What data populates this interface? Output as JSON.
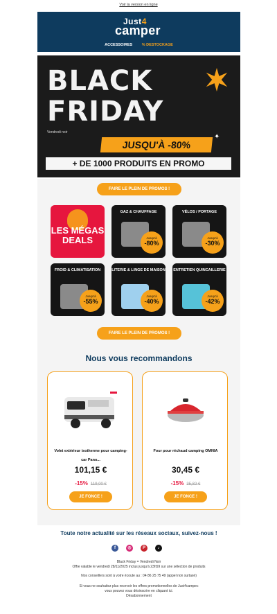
{
  "top_link": "Voir la version en ligne",
  "brand": {
    "line1_a": "Just",
    "line1_b": "4",
    "line2": "camper"
  },
  "nav": {
    "item1": "ACCESSOIRES",
    "item2": "% DESTOCKAGE"
  },
  "hero": {
    "title1": "BLACK",
    "title2": "FRIDAY",
    "small": "Vendredi noir",
    "upto": "JUSQU'À -80%",
    "band": "+ DE 1000 PRODUITS EN PROMO"
  },
  "cta": "FAIRE LE PLEIN DE PROMOS !",
  "categories": [
    {
      "label": "LES MÉGAS DEALS"
    },
    {
      "label": "GAZ & CHAUFFAGE",
      "small": "Jusqu'à",
      "pct": "-80%"
    },
    {
      "label": "VÉLOS / PORTAGE",
      "small": "Jusqu'à",
      "pct": "-30%"
    },
    {
      "label": "FROID & CLIMATISATION",
      "small": "Jusqu'à",
      "pct": "-55%"
    },
    {
      "label": "LITERIE & LINGE DE MAISON",
      "small": "Jusqu'à",
      "pct": "-40%"
    },
    {
      "label": "ENTRETIEN QUINCAILLERIE",
      "small": "Jusqu'à",
      "pct": "-42%"
    }
  ],
  "recommend_title": "Nous vous recommandons",
  "products": [
    {
      "name": "Volet extérieur isotherme pour camping-car Pano...",
      "price": "101,15 €",
      "discount": "-15%",
      "old": "119,00 €",
      "btn": "JE FONCE !"
    },
    {
      "name": "Four pour réchaud camping OMNIA",
      "price": "30,45 €",
      "discount": "-15%",
      "old": "35,82 €",
      "btn": "JE FONCE !"
    }
  ],
  "social_title": "Toute notre actualité sur les réseaux sociaux, suivez-nous !",
  "social": [
    "facebook-icon",
    "instagram-icon",
    "pinterest-icon",
    "tiktok-icon"
  ],
  "footer": {
    "l1": "Black Friday = Vendredi Noir",
    "l2": "Offre valable le vendredi 28/11/2025 inclus jusqu'à 23h59 sur une sélection de produits",
    "l3": "Nos conseillers sont à votre écoute au : 04 86 25 75 49 (appel non surtaxé)",
    "l4": "Si vous ne souhaitez plus recevoir les offres promotionnelles de Just4campec",
    "l5": "vous pouvez vous désinscrire en cliquant ici.",
    "l6": "Désabonnement"
  },
  "colors": {
    "navy": "#0e3b5e",
    "orange": "#f6a11a",
    "red": "#e6163e"
  }
}
